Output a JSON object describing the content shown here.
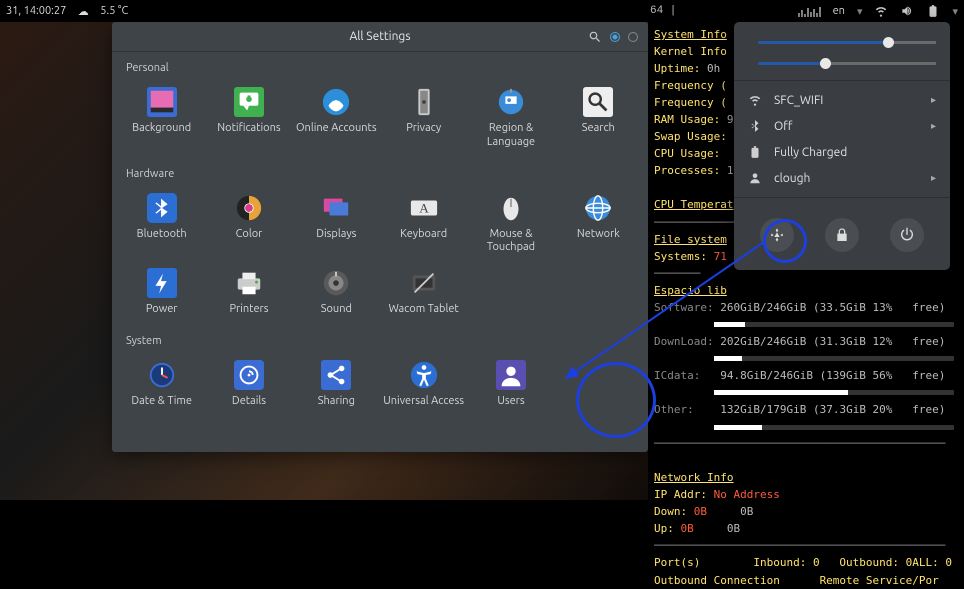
{
  "topbar": {
    "datetime": "31, 14:00:27",
    "temp": "5.5 °C",
    "lang": "en",
    "term_title": "64 |"
  },
  "settings": {
    "title": "All Settings",
    "categories": [
      {
        "name": "Personal",
        "items": [
          {
            "label": "Background",
            "icon": "background"
          },
          {
            "label": "Notifications",
            "icon": "notifications"
          },
          {
            "label": "Online Accounts",
            "icon": "online-accounts"
          },
          {
            "label": "Privacy",
            "icon": "privacy"
          },
          {
            "label": "Region & Language",
            "icon": "region"
          },
          {
            "label": "Search",
            "icon": "search"
          }
        ]
      },
      {
        "name": "Hardware",
        "items": [
          {
            "label": "Bluetooth",
            "icon": "bluetooth"
          },
          {
            "label": "Color",
            "icon": "color"
          },
          {
            "label": "Displays",
            "icon": "displays"
          },
          {
            "label": "Keyboard",
            "icon": "keyboard"
          },
          {
            "label": "Mouse & Touchpad",
            "icon": "mouse"
          },
          {
            "label": "Network",
            "icon": "network"
          },
          {
            "label": "Power",
            "icon": "power"
          },
          {
            "label": "Printers",
            "icon": "printers"
          },
          {
            "label": "Sound",
            "icon": "sound"
          },
          {
            "label": "Wacom Tablet",
            "icon": "wacom"
          }
        ]
      },
      {
        "name": "System",
        "items": [
          {
            "label": "Date & Time",
            "icon": "datetime"
          },
          {
            "label": "Details",
            "icon": "details"
          },
          {
            "label": "Sharing",
            "icon": "sharing"
          },
          {
            "label": "Universal Access",
            "icon": "universal"
          },
          {
            "label": "Users",
            "icon": "users"
          }
        ]
      }
    ]
  },
  "conky": {
    "lines": [
      {
        "t": "head",
        "v": "System Info"
      },
      {
        "t": "line",
        "k": "Kernel Info",
        "v": ""
      },
      {
        "t": "line",
        "k": "Uptime:",
        "v": " 0h"
      },
      {
        "t": "line",
        "k": "Frequency (",
        "v": ""
      },
      {
        "t": "line",
        "k": "Frequency (",
        "v": ""
      },
      {
        "t": "line",
        "k": "RAM Usage:",
        "v": " 9"
      },
      {
        "t": "line",
        "k": "Swap Usage:",
        "v": ""
      },
      {
        "t": "line",
        "k": "CPU Usage:",
        "v": ""
      },
      {
        "t": "line",
        "k": "Processes:",
        "v": " 1"
      },
      {
        "t": "blank"
      },
      {
        "t": "head",
        "v": "CPU Temperat"
      },
      {
        "t": "sep"
      },
      {
        "t": "head",
        "v": "File system"
      },
      {
        "t": "fs",
        "k": "Systems:",
        "v": "71",
        "color": "red"
      },
      {
        "t": "sep2"
      },
      {
        "t": "head",
        "v": "Espacio lib"
      },
      {
        "t": "disk",
        "k": "Software:",
        "v": "260GiB/246GiB (33.5GiB 13%   free)",
        "pct": 13
      },
      {
        "t": "disk",
        "k": "DownLoad:",
        "v": "202GiB/246GiB (31.3GiB 12%   free)",
        "pct": 12
      },
      {
        "t": "disk",
        "k": "ICdata:",
        "v": "  94.8GiB/246GiB (139GiB 56%   free)",
        "pct": 56
      },
      {
        "t": "disk",
        "k": "Other:",
        "v": "   132GiB/179GiB (37.3GiB 20%   free)",
        "pct": 20
      },
      {
        "t": "sep"
      },
      {
        "t": "blank"
      },
      {
        "t": "head",
        "v": "Network Info"
      },
      {
        "t": "netip",
        "k": "IP Addr:",
        "v": "No Address"
      },
      {
        "t": "net",
        "k": "Down:",
        "v": "0B",
        "v2": "0B"
      },
      {
        "t": "net",
        "k": "Up:",
        "v": "0B",
        "v2": "0B"
      },
      {
        "t": "sep"
      },
      {
        "t": "ports",
        "v": "Port(s)        Inbound: 0   Outbound: 0ALL: 0"
      },
      {
        "t": "conn",
        "v": "Outbound Connection      Remote Service/Por"
      }
    ]
  },
  "popover": {
    "volume_pct": 70,
    "brightness_pct": 35,
    "items": [
      {
        "icon": "wifi",
        "label": "SFC_WIFI",
        "chev": true
      },
      {
        "icon": "bluetooth",
        "label": "Off",
        "chev": true
      },
      {
        "icon": "battery",
        "label": "Fully Charged",
        "chev": false
      },
      {
        "icon": "user",
        "label": "clough",
        "chev": true
      }
    ],
    "actions": [
      "settings",
      "lock",
      "power"
    ]
  }
}
